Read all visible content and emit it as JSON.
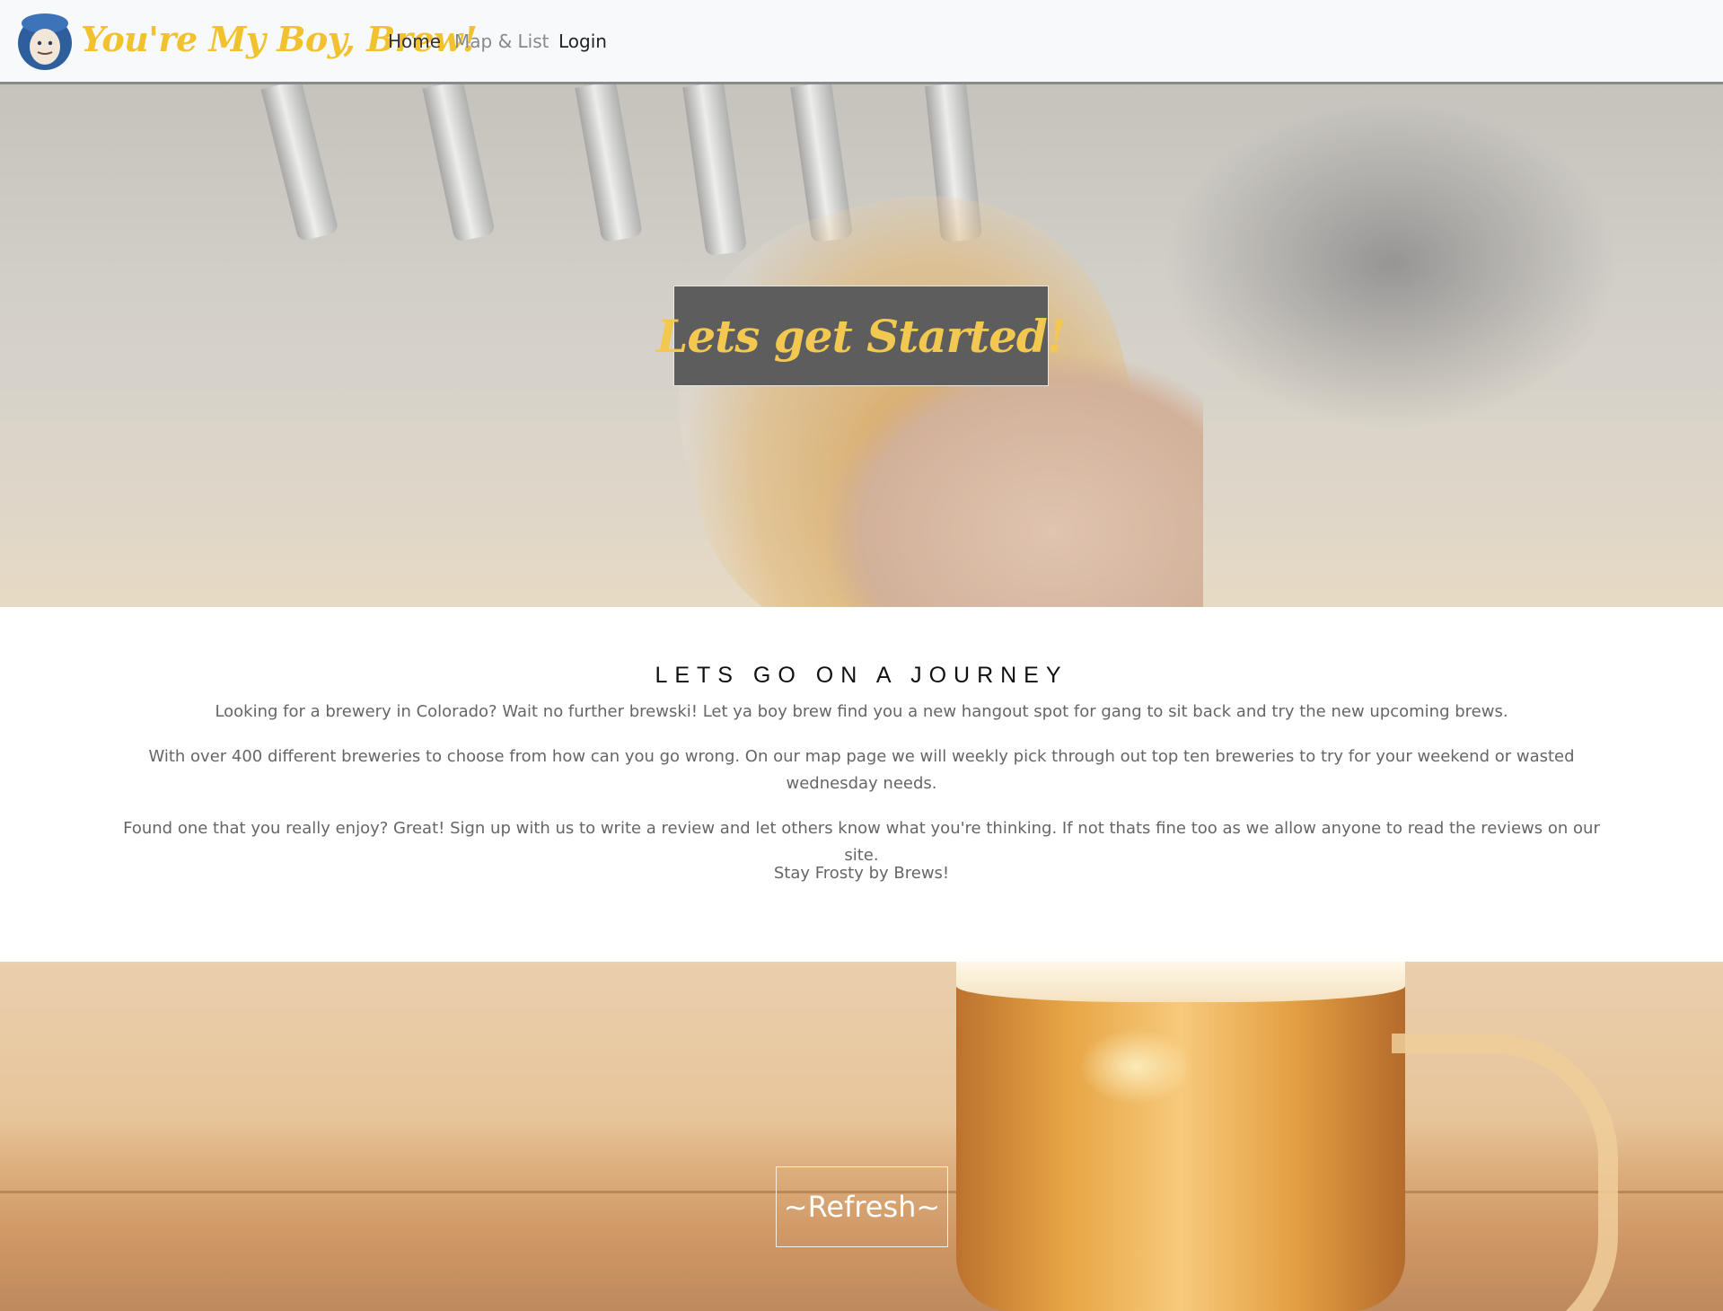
{
  "navbar": {
    "brand": "You're My Boy, Brew!",
    "links": [
      {
        "label": "Home"
      },
      {
        "label": "Map & List"
      },
      {
        "label": "Login"
      }
    ]
  },
  "hero_top": {
    "title": "Lets get Started!"
  },
  "about": {
    "heading": "LETS GO ON A JOURNEY",
    "paragraphs": [
      "Looking for a brewery in Colorado? Wait no further brewski! Let ya boy brew find you a new hangout spot for gang to sit back and try the new upcoming brews.",
      "With over 400 different breweries to choose from how can you go wrong. On our map page we will weekly pick through out top ten breweries to try for your weekend or wasted wednesday needs.",
      "Found one that you really enjoy? Great! Sign up with us to write a review and let others know what you're thinking. If not thats fine too as we allow anyone to read the reviews on our site.",
      "Stay Frosty by Brews!"
    ]
  },
  "hero_bottom": {
    "title": "~Refresh~"
  },
  "colors": {
    "brand": "#f2c12e",
    "hero_title": "#f3c851",
    "hero_box": "#5d5d5d"
  }
}
